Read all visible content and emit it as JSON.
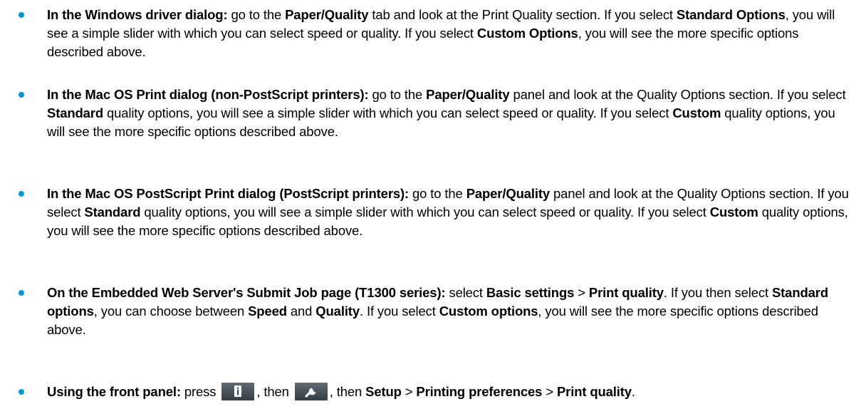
{
  "items": [
    {
      "parts": [
        {
          "t": "In the Windows driver dialog:",
          "b": true
        },
        {
          "t": " go to the "
        },
        {
          "t": "Paper/Quality",
          "b": true
        },
        {
          "t": " tab and look at the Print Quality section. If you select "
        },
        {
          "t": "Standard Options",
          "b": true
        },
        {
          "t": ", you will see a simple slider with which you can select speed or quality. If you select "
        },
        {
          "t": "Custom Options",
          "b": true
        },
        {
          "t": ", you will see the more specific options described above."
        }
      ]
    },
    {
      "parts": [
        {
          "t": "In the Mac OS Print dialog (non-PostScript printers):",
          "b": true
        },
        {
          "t": " go to the "
        },
        {
          "t": "Paper/Quality",
          "b": true
        },
        {
          "t": " panel and look at the Quality Options section. If you select "
        },
        {
          "t": "Standard",
          "b": true
        },
        {
          "t": " quality options, you will see a simple slider with which you can select speed or quality. If you select "
        },
        {
          "t": "Custom",
          "b": true
        },
        {
          "t": " quality options, you will see the more specific options described above."
        }
      ]
    },
    {
      "parts": [
        {
          "t": "In the Mac OS PostScript Print dialog (PostScript printers):",
          "b": true
        },
        {
          "t": " go to the "
        },
        {
          "t": "Paper/Quality",
          "b": true
        },
        {
          "t": " panel and look at the Quality Options section. If you select "
        },
        {
          "t": "Standard",
          "b": true
        },
        {
          "t": " quality options, you will see a simple slider with which you can select speed or quality. If you select "
        },
        {
          "t": "Custom",
          "b": true
        },
        {
          "t": " quality options, you will see the more specific options described above."
        }
      ]
    },
    {
      "parts": [
        {
          "t": "On the Embedded Web Server's Submit Job page (T1300 series):",
          "b": true
        },
        {
          "t": " select "
        },
        {
          "t": "Basic settings",
          "b": true
        },
        {
          "t": " > "
        },
        {
          "t": "Print quality",
          "b": true
        },
        {
          "t": ". If you then select "
        },
        {
          "t": "Standard options",
          "b": true
        },
        {
          "t": ", you can choose between "
        },
        {
          "t": "Speed",
          "b": true
        },
        {
          "t": " and "
        },
        {
          "t": "Quality",
          "b": true
        },
        {
          "t": ". If you select "
        },
        {
          "t": "Custom options",
          "b": true
        },
        {
          "t": ", you will see the more specific options described above."
        }
      ]
    },
    {
      "parts": [
        {
          "t": "Using the front panel:",
          "b": true
        },
        {
          "t": " press "
        },
        {
          "icon": "info-icon"
        },
        {
          "t": ", then "
        },
        {
          "icon": "wrench-icon"
        },
        {
          "t": ", then "
        },
        {
          "t": "Setup",
          "b": true
        },
        {
          "t": " > "
        },
        {
          "t": "Printing preferences",
          "b": true
        },
        {
          "t": " > "
        },
        {
          "t": "Print quality",
          "b": true
        },
        {
          "t": "."
        }
      ]
    }
  ],
  "colors": {
    "bullet": "#0096d6",
    "icon_bg": "#4a5359"
  }
}
